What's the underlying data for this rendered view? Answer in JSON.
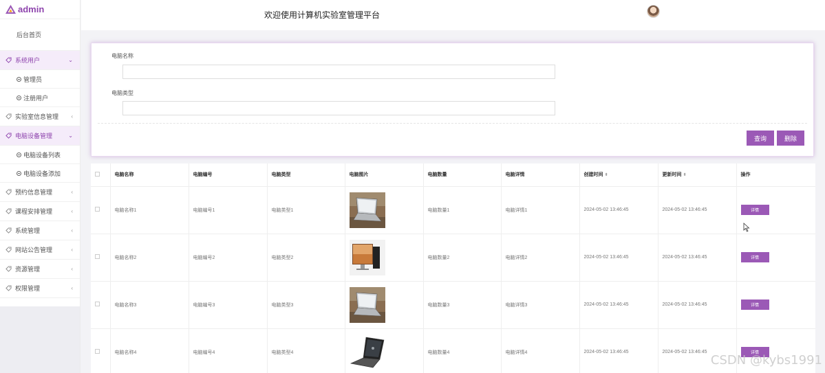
{
  "app": {
    "logo_text": "admin",
    "accent_color": "#9b59b6"
  },
  "header": {
    "title": "欢迎使用计算机实验室管理平台"
  },
  "sidebar": {
    "home": "后台首页",
    "groups": [
      {
        "label": "系统用户",
        "open": true,
        "children": [
          "管理员",
          "注册用户"
        ]
      },
      {
        "label": "实验室信息管理",
        "open": false,
        "children": []
      },
      {
        "label": "电脑设备管理",
        "open": true,
        "children": [
          "电脑设备列表",
          "电脑设备添加"
        ]
      },
      {
        "label": "预约信息管理",
        "open": false,
        "children": []
      },
      {
        "label": "课程安排管理",
        "open": false,
        "children": []
      },
      {
        "label": "系统管理",
        "open": false,
        "children": []
      },
      {
        "label": "网站公告管理",
        "open": false,
        "children": []
      },
      {
        "label": "资源管理",
        "open": false,
        "children": []
      },
      {
        "label": "权限管理",
        "open": false,
        "children": []
      }
    ]
  },
  "search": {
    "name_label": "电脑名称",
    "name_value": "",
    "type_label": "电脑类型",
    "type_value": "",
    "query_button": "查询",
    "delete_button": "删除"
  },
  "table": {
    "columns": [
      "电脑名称",
      "电脑编号",
      "电脑类型",
      "电脑图片",
      "电脑数量",
      "电脑详情",
      "创建时间",
      "更新时间",
      "操作"
    ],
    "detail_button": "详情",
    "rows": [
      {
        "name": "电脑名称1",
        "code": "电脑编号1",
        "type": "电脑类型1",
        "image": "laptop-photo",
        "qty": "电脑数量1",
        "detail": "电脑详情1",
        "created": "2024-05-02 13:46:45",
        "updated": "2024-05-02 13:46:45"
      },
      {
        "name": "电脑名称2",
        "code": "电脑编号2",
        "type": "电脑类型2",
        "image": "desktop-photo",
        "qty": "电脑数量2",
        "detail": "电脑详情2",
        "created": "2024-05-02 13:46:45",
        "updated": "2024-05-02 13:46:45"
      },
      {
        "name": "电脑名称3",
        "code": "电脑编号3",
        "type": "电脑类型3",
        "image": "laptop-photo",
        "qty": "电脑数量3",
        "detail": "电脑详情3",
        "created": "2024-05-02 13:46:45",
        "updated": "2024-05-02 13:46:45"
      },
      {
        "name": "电脑名称4",
        "code": "电脑编号4",
        "type": "电脑类型4",
        "image": "gaming-laptop-photo",
        "qty": "电脑数量4",
        "detail": "电脑详情4",
        "created": "2024-05-02 13:46:45",
        "updated": "2024-05-02 13:46:45"
      }
    ]
  },
  "watermark": "CSDN @kybs1991"
}
